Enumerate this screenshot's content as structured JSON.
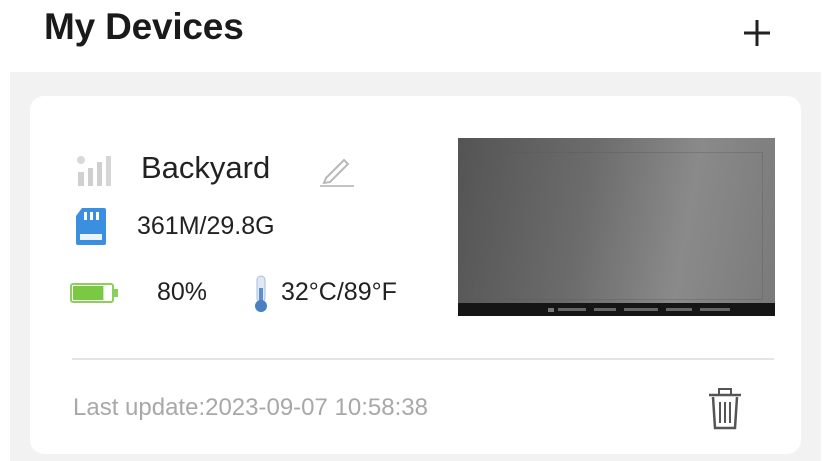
{
  "header": {
    "title": "My Devices",
    "add_icon": "plus-icon"
  },
  "device": {
    "name": "Backyard",
    "signal_icon": "signal-bars-icon",
    "edit_icon": "pencil-icon",
    "storage": {
      "icon": "sd-card-icon",
      "text": "361M/29.8G"
    },
    "battery": {
      "icon": "battery-icon",
      "percent_text": "80%",
      "level": 0.8,
      "color": "#7ac943"
    },
    "temperature": {
      "icon": "thermometer-icon",
      "text": "32°C/89°F"
    },
    "last_update": "Last update:2023-09-07 10:58:38",
    "delete_icon": "trash-icon"
  },
  "colors": {
    "sd_blue": "#3b8fe0",
    "card_background": "#ffffff",
    "list_background": "#f2f2f2",
    "muted_text": "#a8a8a8"
  }
}
